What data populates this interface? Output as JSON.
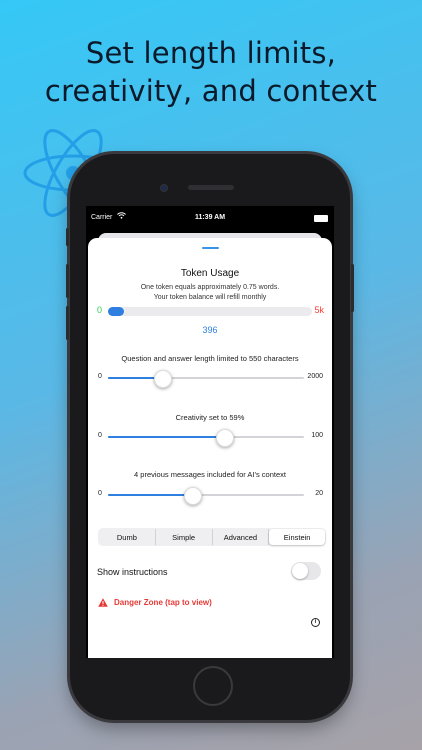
{
  "headline": {
    "line1": "Set length limits,",
    "line2": "creativity, and context"
  },
  "status_bar": {
    "carrier": "Carrier",
    "time": "11:39 AM"
  },
  "token_usage": {
    "title": "Token Usage",
    "subtitle_line1": "One token equals approximately 0.75 words.",
    "subtitle_line2": "Your token balance will refill monthly",
    "min_label": "0",
    "max_label": "5k",
    "value_label": "396",
    "fill_fraction": 0.079,
    "colors": {
      "min": "#34c759",
      "max": "#ff3b30",
      "accent": "#2f7fe0"
    }
  },
  "length_slider": {
    "label": "Question and answer length limited to 550 characters",
    "min_label": "0",
    "max_label": "2000",
    "fraction": 0.275
  },
  "creativity_slider": {
    "label": "Creativity set to 59%",
    "min_label": "0",
    "max_label": "100",
    "fraction": 0.59
  },
  "context_slider": {
    "label": "4 previous messages included for AI's context",
    "min_label": "0",
    "max_label": "20",
    "fraction": 0.43
  },
  "model_segments": {
    "options": [
      "Dumb",
      "Simple",
      "Advanced",
      "Einstein"
    ],
    "selected": "Einstein"
  },
  "instructions_toggle": {
    "label": "Show instructions",
    "on": false
  },
  "danger_zone": {
    "label": "Danger Zone (tap to view)",
    "icon": "warning-icon",
    "color": "#e53935"
  },
  "info": {
    "icon": "info-icon",
    "glyph": "i"
  }
}
